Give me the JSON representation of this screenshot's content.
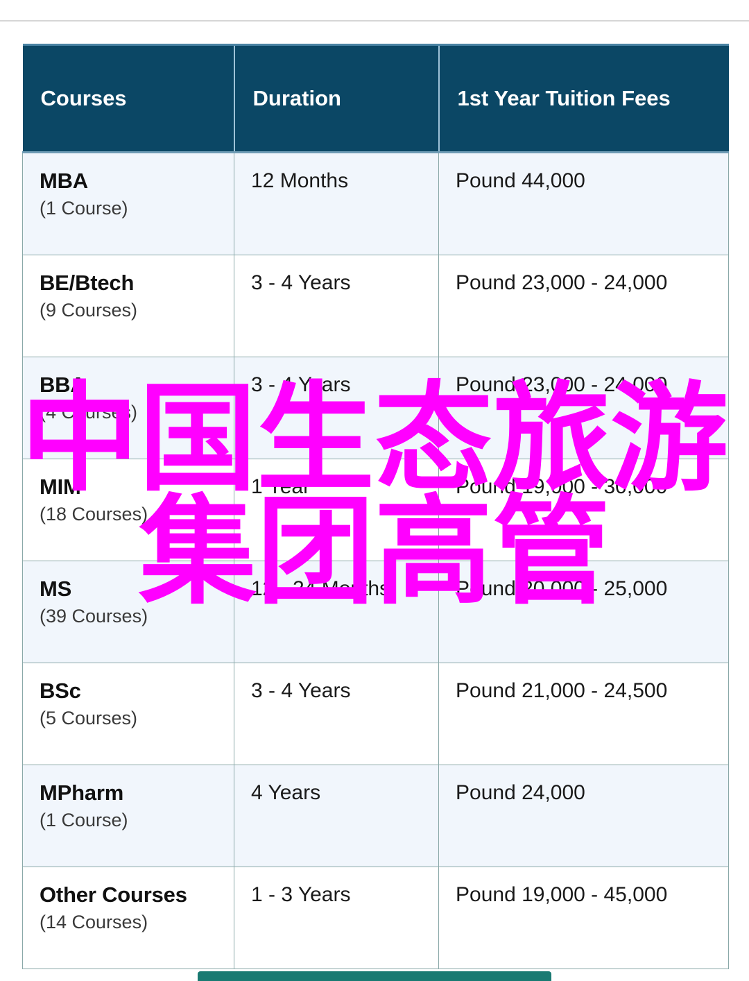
{
  "page": {
    "background_color": "#ffffff",
    "divider_color": "#d6d6d6"
  },
  "table": {
    "name": "course-fees-table",
    "header_bg": "#0b4765",
    "header_text_color": "#ffffff",
    "alt_row_bg": "#f1f6fc",
    "row_bg": "#ffffff",
    "border_color": "#8aa8a8",
    "columns": [
      {
        "key": "course",
        "label": "Courses"
      },
      {
        "key": "duration",
        "label": "Duration"
      },
      {
        "key": "fees",
        "label": "1st Year Tuition Fees"
      }
    ],
    "rows": [
      {
        "course": "MBA",
        "count": "(1 Course)",
        "duration": "12 Months",
        "fees": "Pound 44,000"
      },
      {
        "course": "BE/Btech",
        "count": "(9 Courses)",
        "duration": "3 - 4 Years",
        "fees": "Pound 23,000 - 24,000"
      },
      {
        "course": "BBA",
        "count": "(4 Courses)",
        "duration": "3 - 4 Years",
        "fees": "Pound 23,000 - 24,000"
      },
      {
        "course": "MIM",
        "count": "(18 Courses)",
        "duration": "1 Year",
        "fees": "Pound 19,000 - 30,000"
      },
      {
        "course": "MS",
        "count": "(39 Courses)",
        "duration": "12 - 24 Months",
        "fees": "Pound 20,000 - 25,000"
      },
      {
        "course": "BSc",
        "count": "(5 Courses)",
        "duration": "3 - 4 Years",
        "fees": "Pound 21,000 - 24,500"
      },
      {
        "course": "MPharm",
        "count": "(1 Course)",
        "duration": "4 Years",
        "fees": "Pound 24,000"
      },
      {
        "course": "Other Courses",
        "count": "(14 Courses)",
        "duration": "1 - 3 Years",
        "fees": "Pound 19,000 - 45,000"
      }
    ]
  },
  "overlay": {
    "color": "#ff00ff",
    "line1": "中国生态旅游",
    "line2": "集团高管"
  },
  "bottom_bar": {
    "color": "#197a72"
  }
}
